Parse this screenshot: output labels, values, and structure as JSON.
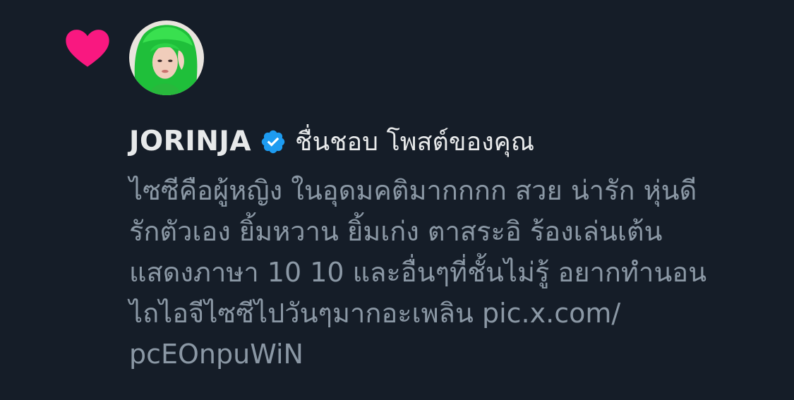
{
  "notification": {
    "icon": "heart-icon",
    "icon_color": "#f91880",
    "user": {
      "avatar": "avatar",
      "name": "JORINJA",
      "verified_icon": "verified-badge-icon",
      "verified_color": "#1d9bf0"
    },
    "action_text": "ชื่นชอบ โพสต์ของคุณ",
    "tweet_lines": [
      "ไซซีคือผู้หญิง ในอุดมคติมากกกก สวย น่ารัก หุ่นดี",
      "รักตัวเอง ยิ้มหวาน ยิ้มเก่ง ตาสระอิ ร้องเล่นเต้น",
      "แสดงภาษา 10 10 และอื่นๆที่ชั้นไม่รู้ อยากทำนอน",
      "ไถไอจีไซซีไปวันๆมากอะเพลิน pic.x.com/",
      "pcEOnpuWiN"
    ]
  },
  "theme": {
    "background": "#151d28",
    "primary_text": "#e7e9ea",
    "secondary_text": "#8b98a5"
  }
}
